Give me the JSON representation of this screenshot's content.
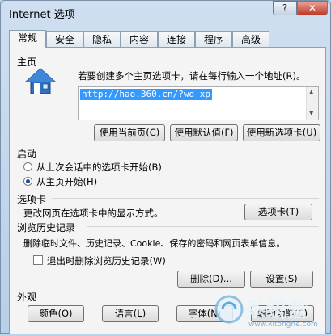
{
  "window": {
    "title": "Internet 选项",
    "help_label": "?",
    "close_label": "✕"
  },
  "tabs": [
    {
      "label": "常规",
      "active": true
    },
    {
      "label": "安全"
    },
    {
      "label": "隐私"
    },
    {
      "label": "内容"
    },
    {
      "label": "连接"
    },
    {
      "label": "程序"
    },
    {
      "label": "高级"
    }
  ],
  "homepage": {
    "section_label": "主页",
    "instruction": "若要创建多个主页选项卡，请在每行输入一个地址(R)。",
    "url_value": "http://hao.360.cn/?wd_xp",
    "btn_use_current": "使用当前页(C)",
    "btn_use_default": "使用默认值(F)",
    "btn_use_new_tab": "使用新选项卡(U)"
  },
  "startup": {
    "section_label": "启动",
    "option_last_session": "从上次会话中的选项卡开始(B)",
    "option_homepage": "从主页开始(H)",
    "selected": "homepage"
  },
  "tabs_section": {
    "section_label": "选项卡",
    "description": "更改网页在选项卡中的显示方式。",
    "btn_tabs": "选项卡(T)"
  },
  "history": {
    "section_label": "浏览历史记录",
    "description": "删除临时文件、历史记录、Cookie、保存的密码和网页表单信息。",
    "checkbox_label": "退出时删除浏览历史记录(W)",
    "checkbox_checked": false,
    "btn_delete": "删除(D)...",
    "btn_settings": "设置(S)"
  },
  "appearance": {
    "section_label": "外观",
    "btn_colors": "颜色(O)",
    "btn_languages": "语言(L)",
    "btn_fonts": "字体(N)",
    "btn_accessibility": "辅助功能(E)"
  },
  "watermark": {
    "text": "系统盒",
    "url": "www.xitonghe.com"
  }
}
